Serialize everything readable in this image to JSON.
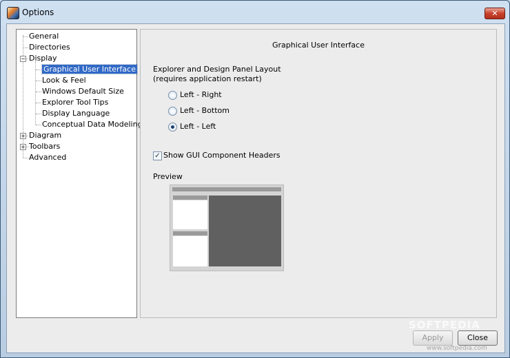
{
  "window": {
    "title": "Options",
    "close_glyph": "✕"
  },
  "tree": {
    "items": [
      {
        "label": "General",
        "level": 0
      },
      {
        "label": "Directories",
        "level": 0
      },
      {
        "label": "Display",
        "level": 0,
        "expander": "−"
      },
      {
        "label": "Graphical User Interface",
        "level": 1,
        "selected": true
      },
      {
        "label": "Look & Feel",
        "level": 1
      },
      {
        "label": "Windows Default Size",
        "level": 1
      },
      {
        "label": "Explorer Tool Tips",
        "level": 1
      },
      {
        "label": "Display Language",
        "level": 1
      },
      {
        "label": "Conceptual Data Modeling",
        "level": 1
      },
      {
        "label": "Diagram",
        "level": 0,
        "expander": "+"
      },
      {
        "label": "Toolbars",
        "level": 0,
        "expander": "+"
      },
      {
        "label": "Advanced",
        "level": 0
      }
    ]
  },
  "panel": {
    "title": "Graphical User Interface",
    "layout_label_line1": "Explorer and Design Panel Layout",
    "layout_label_line2": "(requires application restart)",
    "radios": [
      {
        "label": "Left - Right",
        "checked": false
      },
      {
        "label": "Left - Bottom",
        "checked": false
      },
      {
        "label": "Left - Left",
        "checked": true
      }
    ],
    "checkbox": {
      "label": "Show GUI Component Headers",
      "checked": true,
      "glyph": "✓"
    },
    "preview_label": "Preview"
  },
  "buttons": {
    "apply": "Apply",
    "close": "Close"
  },
  "watermark": {
    "main": "SOFTPEDIA",
    "sub": "www.softpedia.com"
  }
}
